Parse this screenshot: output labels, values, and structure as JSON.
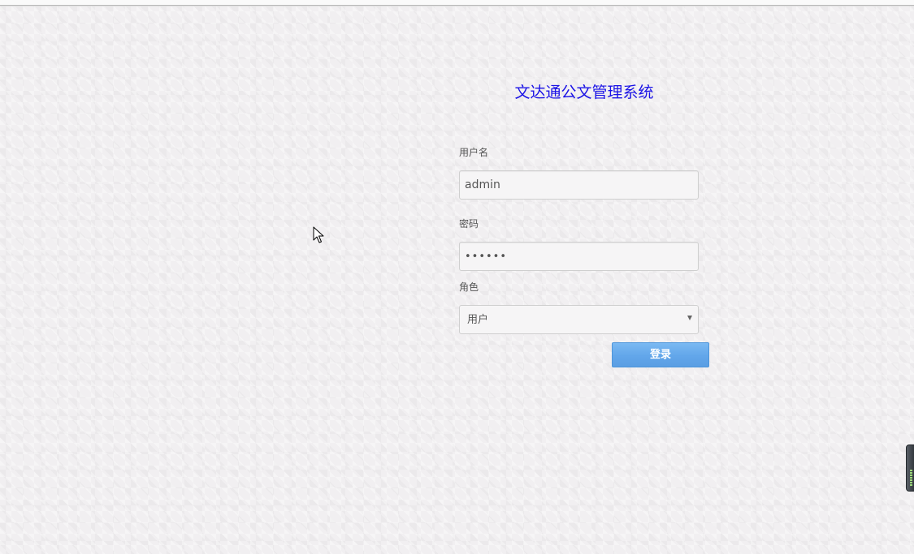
{
  "page": {
    "title": "文达通公文管理系统"
  },
  "form": {
    "username_label": "用户名",
    "username_value": "admin",
    "password_label": "密码",
    "password_value": "111111",
    "role_label": "角色",
    "role_selected": "用户",
    "login_button": "登录"
  },
  "colors": {
    "title": "#1a12e6",
    "button": "#62a6ea"
  }
}
